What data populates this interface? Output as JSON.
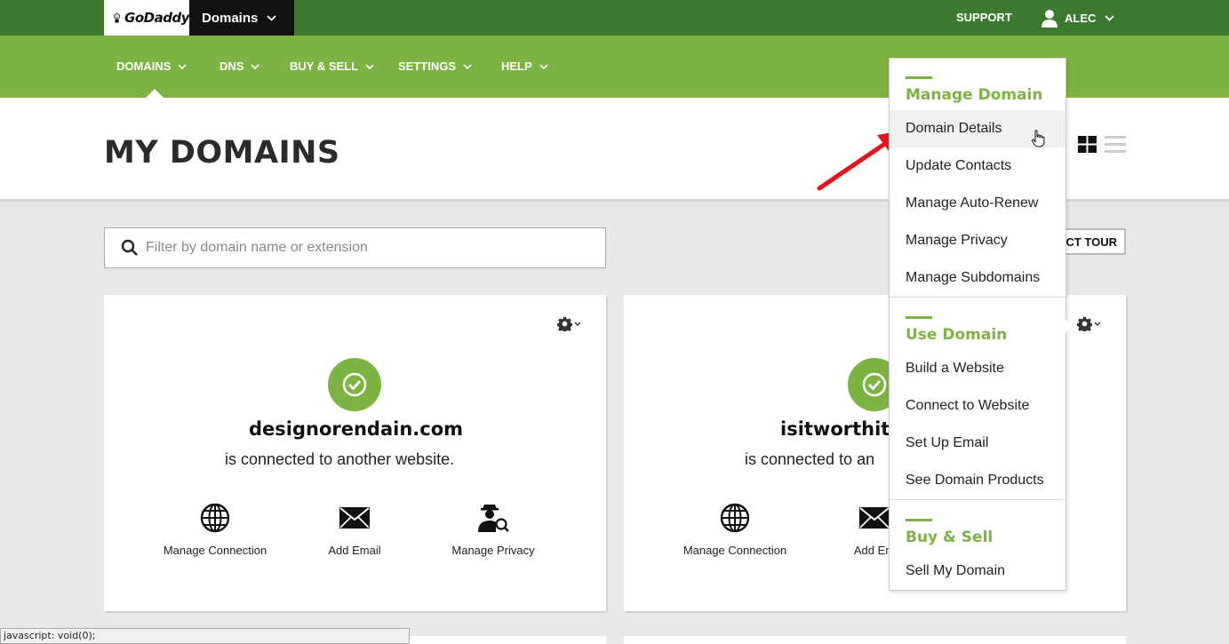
{
  "topbar": {
    "logo_text": "GoDaddy",
    "product": "Domains",
    "support": "SUPPORT",
    "account": "ALEC"
  },
  "nav": {
    "items": [
      "DOMAINS",
      "DNS",
      "BUY & SELL",
      "SETTINGS",
      "HELP"
    ]
  },
  "header": {
    "title": "MY DOMAINS"
  },
  "filter": {
    "placeholder": "Filter by domain name or extension"
  },
  "tour_button": "CT TOUR",
  "cards": [
    {
      "domain": "designorendain.com",
      "message": "is connected to another website.",
      "actions": [
        "Manage Connection",
        "Add Email",
        "Manage Privacy"
      ]
    },
    {
      "domain": "isitworthitg",
      "message": "is connected to an",
      "actions": [
        "Manage Connection",
        "Add Em"
      ]
    }
  ],
  "menu": {
    "sections": [
      {
        "heading": "Manage Domain",
        "items": [
          "Domain Details",
          "Update Contacts",
          "Manage Auto-Renew",
          "Manage Privacy",
          "Manage Subdomains"
        ]
      },
      {
        "heading": "Use Domain",
        "items": [
          "Build a Website",
          "Connect to Website",
          "Set Up Email",
          "See Domain Products"
        ]
      },
      {
        "heading": "Buy & Sell",
        "items": [
          "Sell My Domain"
        ]
      }
    ]
  },
  "statusbar": "javascript: void(0);",
  "colors": {
    "topbar": "#3c7a31",
    "navbar": "#7db343",
    "accent": "#7db343",
    "arrow": "#e8141b"
  }
}
